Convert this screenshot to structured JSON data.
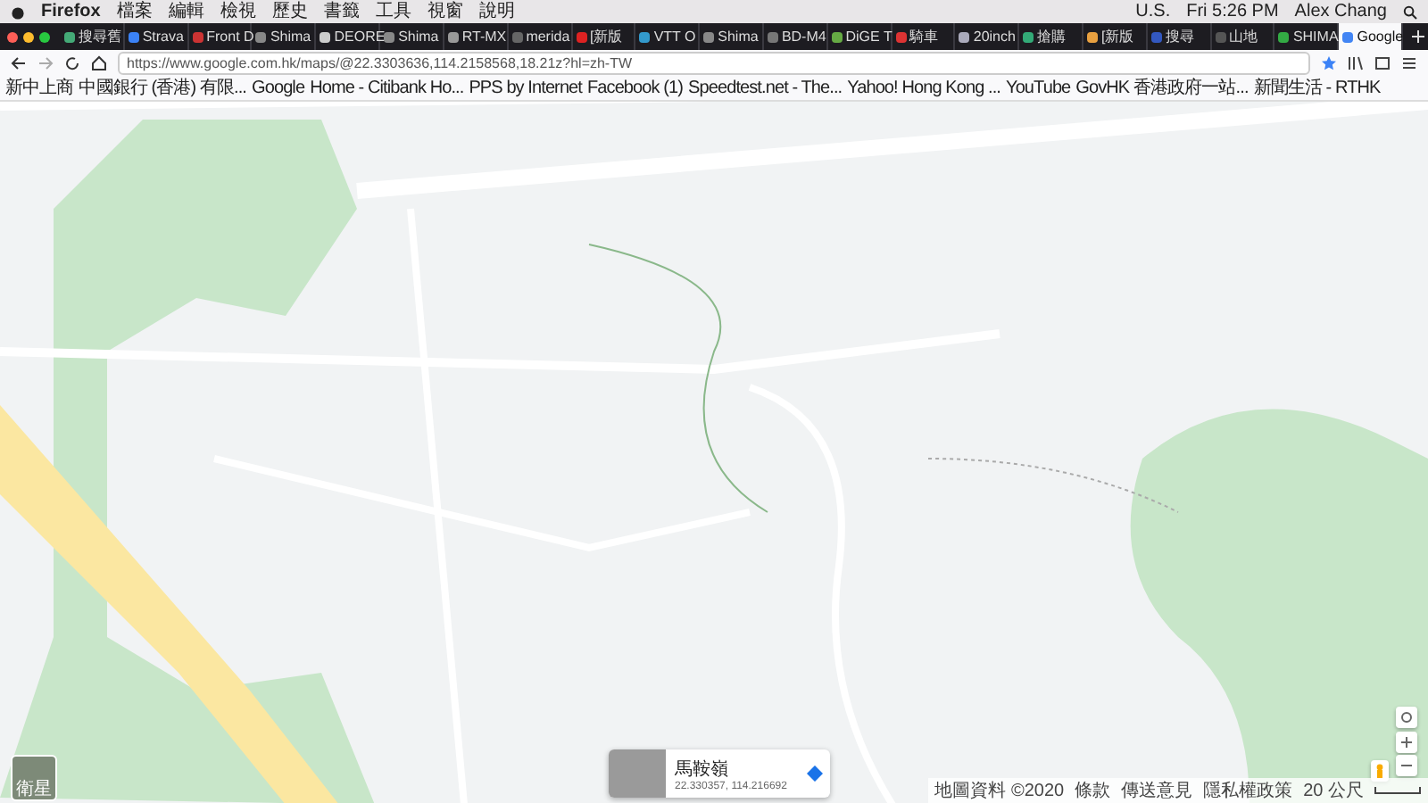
{
  "menu_bar": {
    "app": "Firefox",
    "menus": [
      "檔案",
      "編輯",
      "檢視",
      "歷史",
      "書籤",
      "工具",
      "視窗",
      "說明"
    ],
    "status": [
      "U.S.",
      "Fri 5:26 PM",
      "Alex Chang"
    ]
  },
  "tabs": [
    {
      "label": "搜尋舊",
      "selected": false
    },
    {
      "label": "Strava",
      "selected": false
    },
    {
      "label": "Front D",
      "selected": false
    },
    {
      "label": "Shima",
      "selected": false
    },
    {
      "label": "DEORE",
      "selected": false
    },
    {
      "label": "Shima",
      "selected": false
    },
    {
      "label": "RT-MX",
      "selected": false
    },
    {
      "label": "merida",
      "selected": false
    },
    {
      "label": "[新版",
      "selected": false
    },
    {
      "label": "VTT O",
      "selected": false
    },
    {
      "label": "Shima",
      "selected": false
    },
    {
      "label": "BD-M4",
      "selected": false
    },
    {
      "label": "DiGE T",
      "selected": false
    },
    {
      "label": "騎車",
      "selected": false
    },
    {
      "label": "20inch",
      "selected": false
    },
    {
      "label": "搶購",
      "selected": false
    },
    {
      "label": "[新版",
      "selected": false
    },
    {
      "label": "搜尋",
      "selected": false
    },
    {
      "label": "山地",
      "selected": false
    },
    {
      "label": "SHIMA",
      "selected": false
    },
    {
      "label": "Google",
      "selected": true
    }
  ],
  "address_bar": {
    "url": "https://www.google.com.hk/maps/@22.3303636,114.2158568,18.21z?hl=zh-TW"
  },
  "bookmarks": [
    "新中上商",
    "中國銀行 (香港) 有限...",
    "Google",
    "Home - Citibank Ho...",
    "PPS by Internet",
    "Facebook (1)",
    "Speedtest.net - The...",
    "Yahoo! Hong Kong ...",
    "YouTube",
    "GovHK 香港政府一站...",
    "新聞生活 - RTHK"
  ],
  "map": {
    "info_card": {
      "title": "馬鞍嶺",
      "coords": "22.330357, 114.216692"
    },
    "satellite_toggle": {
      "label": "衛星"
    },
    "footer": [
      "地圖資料 ©2020",
      "條款",
      "傳送意見",
      "隱私權政策"
    ],
    "scale": "20 公尺"
  }
}
